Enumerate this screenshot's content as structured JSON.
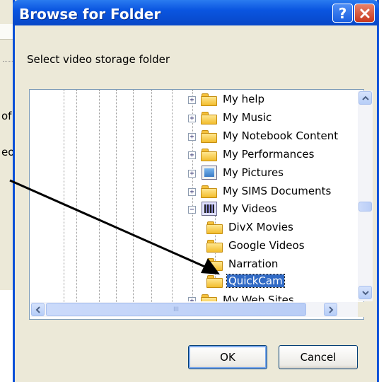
{
  "background_window": {
    "fragment_1": "of",
    "fragment_2": "eo"
  },
  "dialog": {
    "title": "Browse for Folder",
    "help_button": "?",
    "close_button": "✕",
    "prompt": "Select video storage folder",
    "ok_label": "OK",
    "cancel_label": "Cancel"
  },
  "tree": {
    "items": [
      {
        "label": "My help",
        "expander": "+",
        "icon": "folder-icon"
      },
      {
        "label": "My Music",
        "expander": "+",
        "icon": "folder-icon"
      },
      {
        "label": "My Notebook Content",
        "expander": "+",
        "icon": "folder-icon"
      },
      {
        "label": "My Performances",
        "expander": "+",
        "icon": "folder-icon"
      },
      {
        "label": "My Pictures",
        "expander": "+",
        "icon": "pictures-folder-icon"
      },
      {
        "label": "My SIMS Documents",
        "expander": "+",
        "icon": "folder-icon"
      },
      {
        "label": "My Videos",
        "expander": "−",
        "icon": "videos-folder-icon"
      },
      {
        "label": "DivX Movies",
        "icon": "folder-icon"
      },
      {
        "label": "Google Videos",
        "icon": "folder-icon"
      },
      {
        "label": "Narration",
        "icon": "folder-icon"
      },
      {
        "label": "QuickCam",
        "icon": "folder-icon",
        "selected": true
      },
      {
        "label": "My Web Sites",
        "expander": "+",
        "icon": "folder-icon"
      }
    ],
    "hscroll_grip": "III"
  },
  "colors": {
    "title_bar": "#0a55e0",
    "selection": "#316ac5",
    "dialog_face": "#ece9d8"
  }
}
